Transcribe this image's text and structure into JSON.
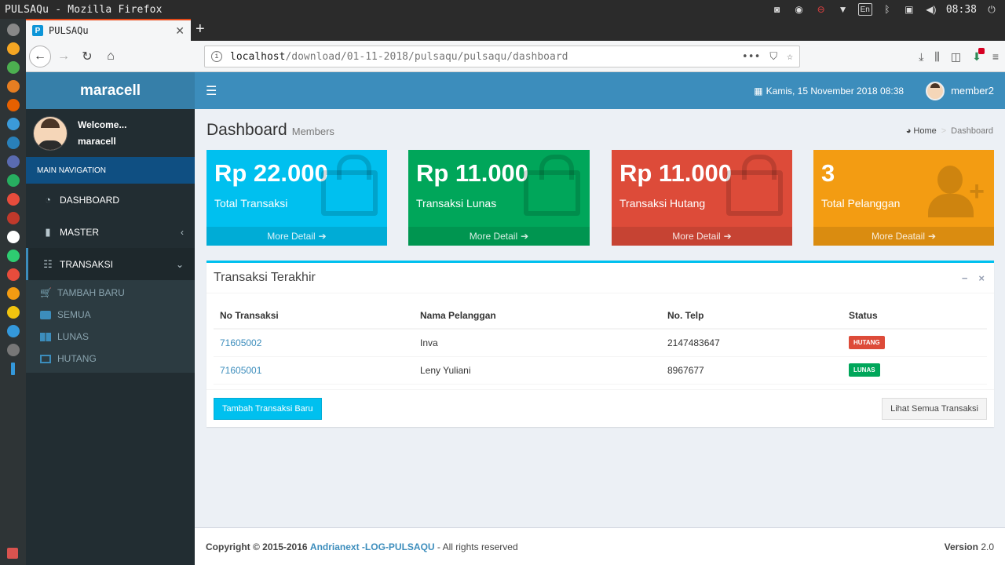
{
  "os": {
    "window_title": "PULSAQu - Mozilla Firefox",
    "keyboard_layout": "En",
    "clock": "08:38"
  },
  "browser": {
    "tab_title": "PULSAQu",
    "favicon_letter": "P",
    "url_host": "localhost",
    "url_path": "/download/01-11-2018/pulsaqu/pulsaqu/dashboard",
    "url_actions": "•••"
  },
  "app": {
    "logo": "maracell",
    "header_date": "Kamis, 15 November 2018 08:38",
    "header_user": "member2",
    "sidebar": {
      "welcome": "Welcome...",
      "username": "maracell",
      "nav_header": "MAIN NAVIGATION",
      "items": [
        {
          "label": "DASHBOARD",
          "icon": "dashboard-icon"
        },
        {
          "label": "MASTER",
          "icon": "briefcase-icon"
        },
        {
          "label": "TRANSAKSI",
          "icon": "table-icon"
        }
      ],
      "subitems": [
        {
          "label": "TAMBAH BARU",
          "icon": "cart-icon"
        },
        {
          "label": "SEMUA",
          "icon": "list-icon"
        },
        {
          "label": "LUNAS",
          "icon": "grid-icon"
        },
        {
          "label": "HUTANG",
          "icon": "note-icon"
        }
      ]
    },
    "page": {
      "title": "Dashboard",
      "subtitle": "Members",
      "breadcrumb_home": "Home",
      "breadcrumb_current": "Dashboard"
    },
    "stats": [
      {
        "value": "Rp 22.000",
        "label": "Total Transaksi",
        "link": "More Detail",
        "color": "#00c0ef"
      },
      {
        "value": "Rp 11.000",
        "label": "Transaksi Lunas",
        "link": "More Detail",
        "color": "#00a65a"
      },
      {
        "value": "Rp 11.000",
        "label": "Transaksi Hutang",
        "link": "More Detail",
        "color": "#dd4b39"
      },
      {
        "value": "3",
        "label": "Total Pelanggan",
        "link": "More Deatail",
        "color": "#f39c12"
      }
    ],
    "recent": {
      "title": "Transaksi Terakhir",
      "minimize": "−",
      "close": "×",
      "columns": [
        "No Transaksi",
        "Nama Pelanggan",
        "No. Telp",
        "Status"
      ],
      "rows": [
        {
          "no": "71605002",
          "nama": "Inva",
          "telp": "2147483647",
          "status": "HUTANG",
          "status_color": "#dd4b39"
        },
        {
          "no": "71605001",
          "nama": "Leny Yuliani",
          "telp": "8967677",
          "status": "LUNAS",
          "status_color": "#00a65a"
        }
      ],
      "add_button": "Tambah Transaksi Baru",
      "view_all_button": "Lihat Semua Transaksi"
    },
    "footer": {
      "copyright": "Copyright © 2015-2016",
      "author": "Andrianext -LOG-PULSAQU",
      "rights": "- All rights reserved",
      "version_label": "Version",
      "version": "2.0"
    }
  }
}
